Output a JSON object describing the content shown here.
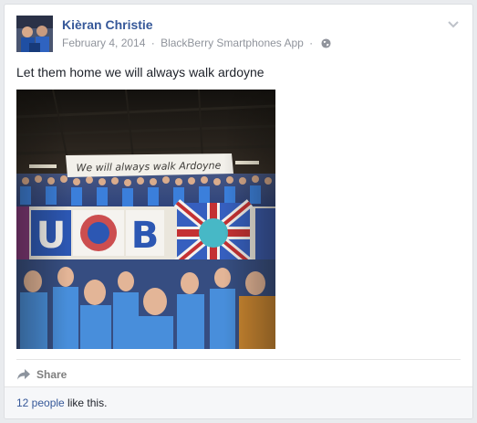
{
  "post": {
    "author": "Kièran Christie",
    "date": "February 4, 2014",
    "separator": "·",
    "via": "BlackBerry Smartphones App",
    "privacy_icon": "globe-icon",
    "status_text": "Let them home we will always walk ardoyne",
    "photo": {
      "banner_text": "We will always walk Ardoyne",
      "flag_letters": "UB"
    }
  },
  "actions": {
    "share_label": "Share",
    "share_icon": "share-arrow-icon"
  },
  "likes": {
    "count_link": "12 people",
    "suffix": " like this."
  },
  "colors": {
    "link": "#365899",
    "meta": "#90949c",
    "footer_bg": "#f6f7f9"
  }
}
